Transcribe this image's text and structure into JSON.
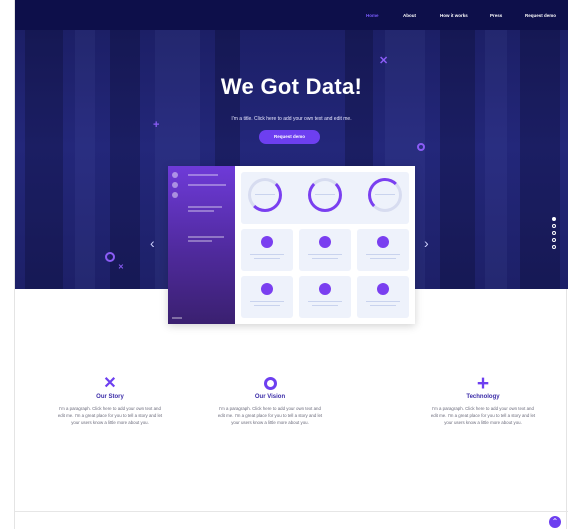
{
  "nav": {
    "items": [
      {
        "label": "Home",
        "active": true
      },
      {
        "label": "About",
        "active": false
      },
      {
        "label": "How it works",
        "active": false
      },
      {
        "label": "Press",
        "active": false
      },
      {
        "label": "Request demo",
        "active": false
      }
    ]
  },
  "hero": {
    "title": "We Got Data!",
    "subtitle": "I'm a title. Click here to add your own text and edit me.",
    "button_label": "Request demo",
    "slides_total": 5,
    "slide_active": 1
  },
  "features": [
    {
      "icon": "x-mark-icon",
      "title": "Our Story",
      "text": "I'm a paragraph. Click here to add your own text and edit me. I'm a great place for you to tell a story and let your users know a little more about you."
    },
    {
      "icon": "circle-icon",
      "title": "Our Vision",
      "text": "I'm a paragraph. Click here to add your own text and edit me. I'm a great place for you to tell a story and let your users know a little more about you."
    },
    {
      "icon": "plus-icon",
      "title": "Technology",
      "text": "I'm a paragraph. Click here to add your own text and edit me. I'm a great place for you to tell a story and let your users know a little more about you."
    }
  ],
  "colors": {
    "nav_bg": "#0d0f4a",
    "accent": "#6d3ff0",
    "hero_bg": "#23277a",
    "feature_title": "#3b2ca8"
  }
}
